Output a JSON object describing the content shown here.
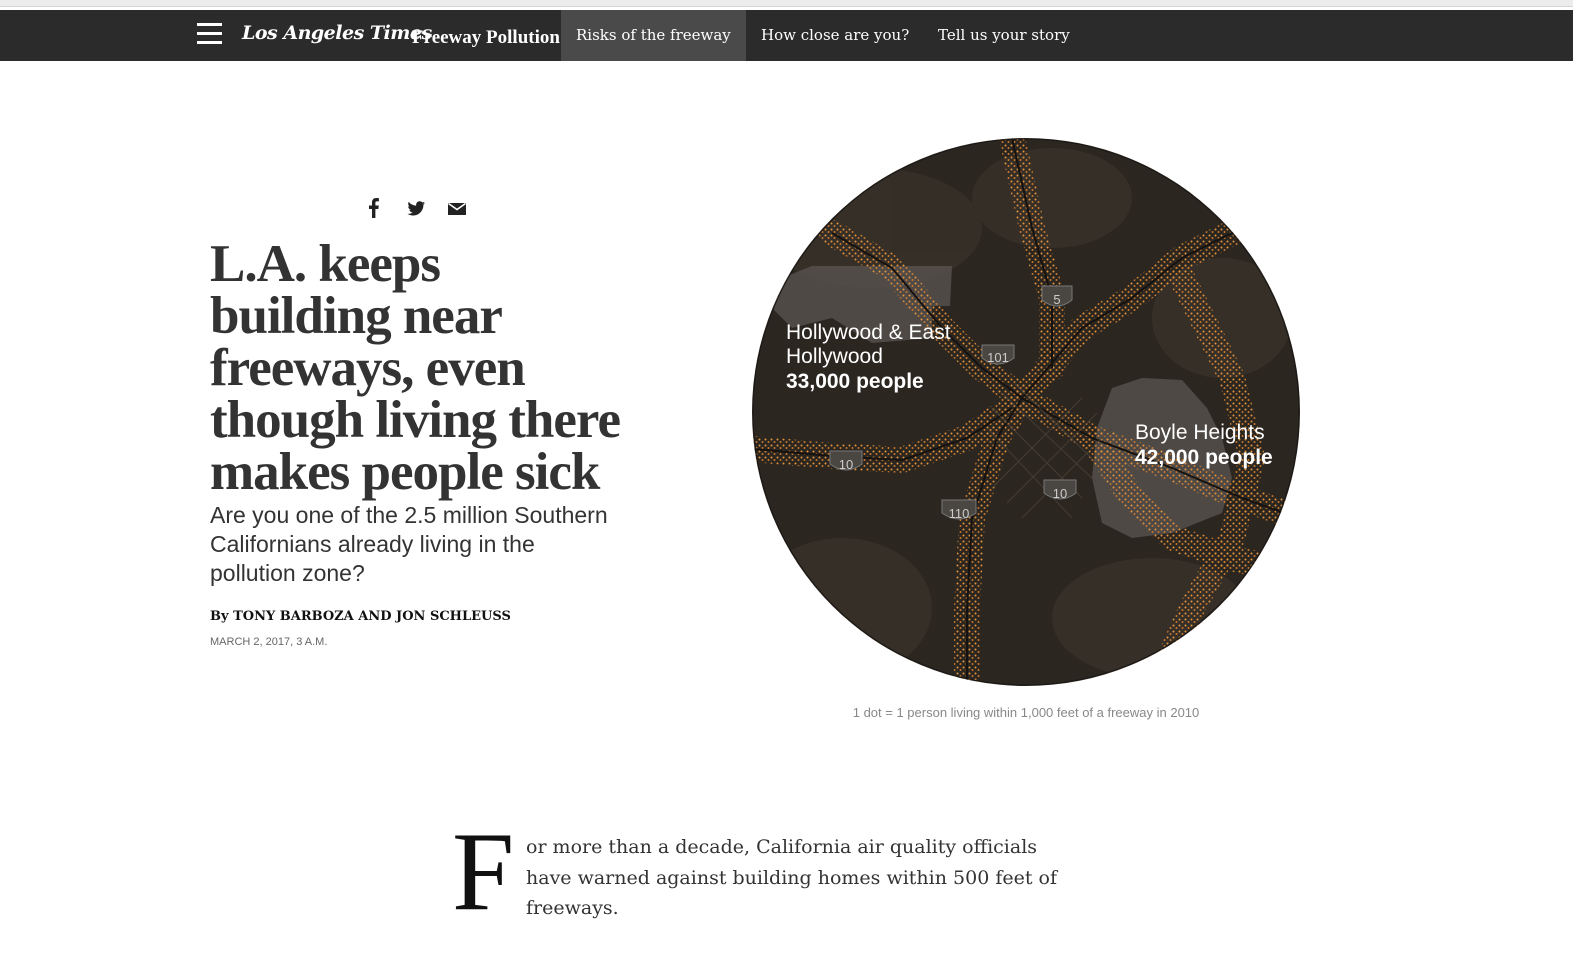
{
  "nav": {
    "logo": "Los Angeles Times",
    "section": "Freeway Pollution",
    "items": [
      {
        "label": "Risks of the freeway",
        "active": true
      },
      {
        "label": "How close are you?"
      },
      {
        "label": "Tell us your story"
      }
    ]
  },
  "share": {
    "icons": [
      "facebook-icon",
      "twitter-icon",
      "email-icon"
    ]
  },
  "article": {
    "headline": "L.A. keeps building near freeways, even though living there makes people sick",
    "dek": "Are you one of the 2.5 million Southern Californians already living in the pollution zone?",
    "byline": "By TONY BARBOZA AND JON SCHLEUSS",
    "date": "March 2, 2017, 3 a.m.",
    "dropcap": "F",
    "first_paragraph": "or more than a decade, California air quality officials have warned against building homes within 500 feet of freeways."
  },
  "map": {
    "labels": {
      "hollywood_name_1": "Hollywood & East",
      "hollywood_name_2": "Hollywood",
      "hollywood_count": "33,000 people",
      "boyle_name": "Boyle Heights",
      "boyle_count": "42,000 people"
    },
    "shields": {
      "i5": "5",
      "us101": "101",
      "i10_west": "10",
      "i10_east": "10",
      "i110": "110"
    },
    "caption": "1 dot = 1 person living within 1,000 feet of a freeway in 2010",
    "colors": {
      "background": "#2c2620",
      "freeway_zone": "#d9873a",
      "neighborhood": "#5a5652"
    }
  }
}
